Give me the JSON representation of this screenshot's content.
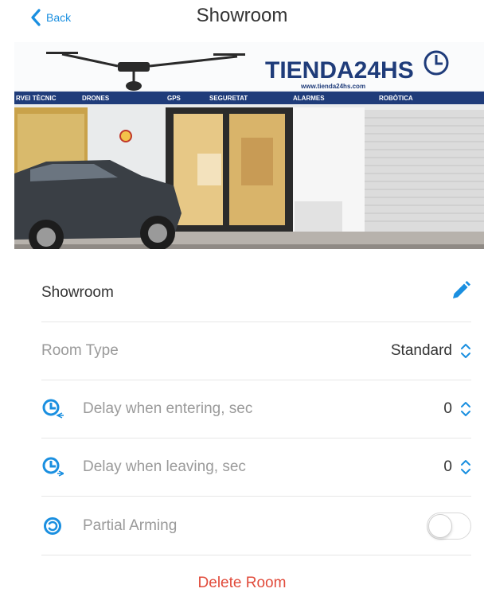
{
  "header": {
    "back_label": "Back",
    "title": "Showroom"
  },
  "photo": {
    "store_name": "TIENDA24HS",
    "store_url": "www.tienda24hs.com",
    "signs": [
      "RVEI TÈCNIC",
      "DRONES",
      "GPS",
      "SEGURETAT",
      "ALARMES",
      "ROBÒTICA"
    ]
  },
  "room": {
    "name": "Showroom",
    "type_label": "Room Type",
    "type_value": "Standard",
    "entering_label": "Delay when entering, sec",
    "entering_value": "0",
    "leaving_label": "Delay when leaving, sec",
    "leaving_value": "0",
    "partial_label": "Partial Arming",
    "partial_enabled": false
  },
  "actions": {
    "delete_label": "Delete Room"
  },
  "colors": {
    "accent": "#1a8fe0",
    "danger": "#e14b3b",
    "muted_text": "#9a9a9a",
    "divider": "#e6e6e6"
  },
  "icons": {
    "back": "chevron-left-icon",
    "edit": "pencil-icon",
    "stepper": "chevron-up-down-icon",
    "enter_delay": "clock-arrow-left-icon",
    "exit_delay": "clock-arrow-right-icon",
    "partial": "partial-arming-icon"
  }
}
